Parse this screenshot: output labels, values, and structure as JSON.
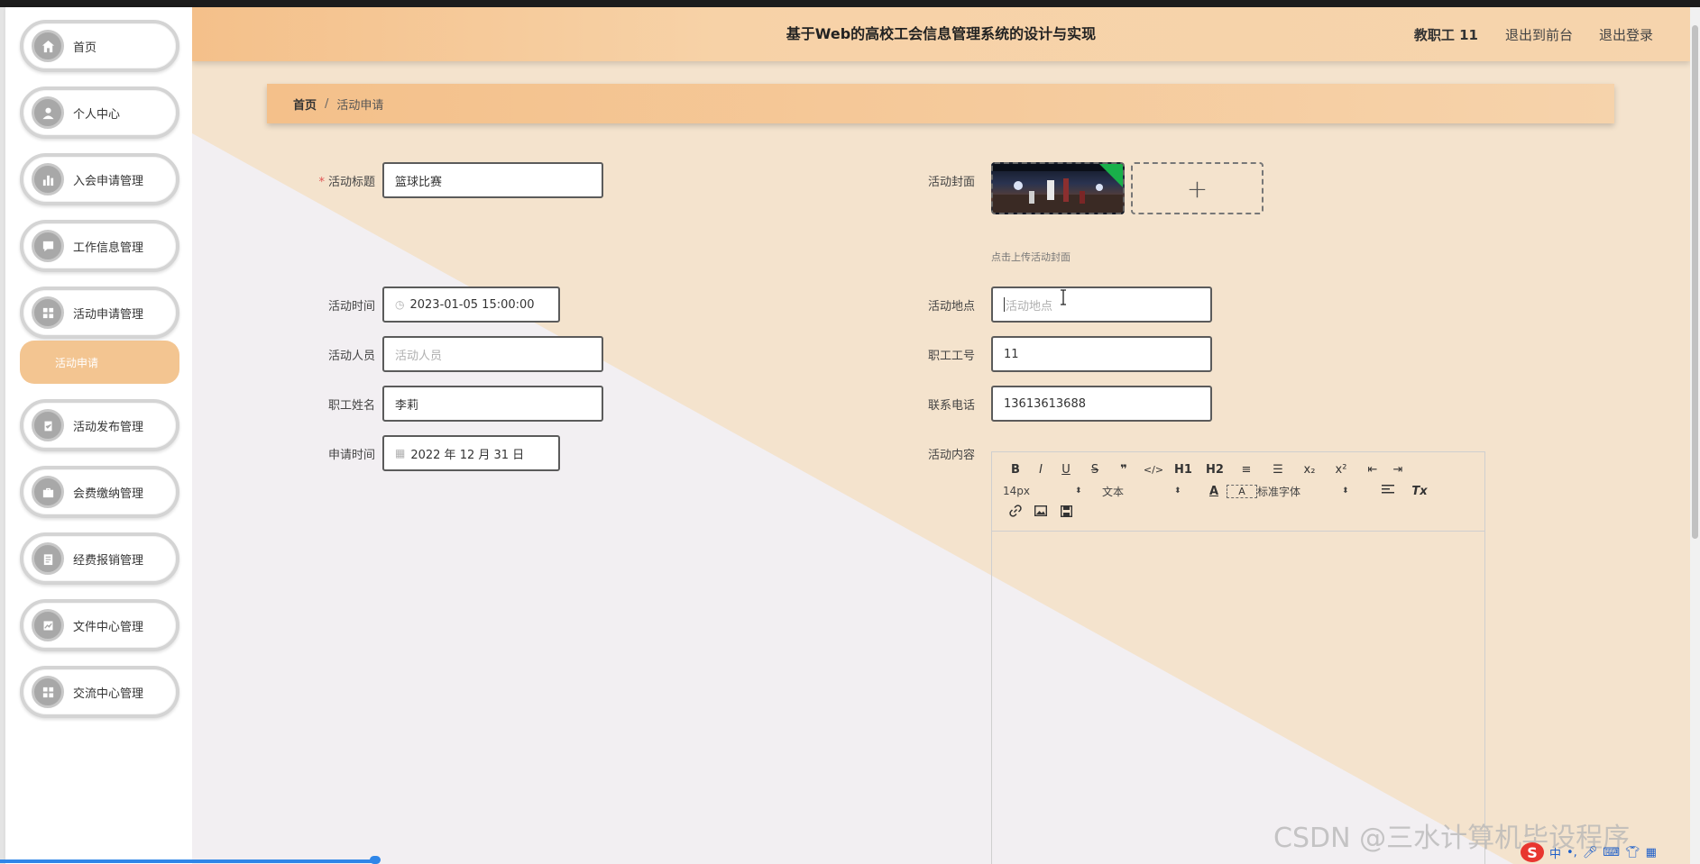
{
  "header": {
    "title": "基于Web的高校工会信息管理系统的设计与实现",
    "user": "教职工 11",
    "links": [
      "退出到前台",
      "退出登录"
    ]
  },
  "sidebar": {
    "items": [
      {
        "label": "首页",
        "icon": "home-icon"
      },
      {
        "label": "个人中心",
        "icon": "user-icon"
      },
      {
        "label": "入会申请管理",
        "icon": "bar-chart-icon"
      },
      {
        "label": "工作信息管理",
        "icon": "chat-icon"
      },
      {
        "label": "活动申请管理",
        "icon": "grid-icon"
      },
      {
        "label": "活动发布管理",
        "icon": "clipboard-check-icon"
      },
      {
        "label": "会费缴纳管理",
        "icon": "briefcase-icon"
      },
      {
        "label": "经费报销管理",
        "icon": "clipboard-icon"
      },
      {
        "label": "文件中心管理",
        "icon": "image-chart-icon"
      },
      {
        "label": "交流中心管理",
        "icon": "grid-icon"
      }
    ],
    "active_sub": "活动申请"
  },
  "breadcrumb": {
    "home": "首页",
    "sep": "/",
    "current": "活动申请"
  },
  "form": {
    "title": {
      "label": "活动标题",
      "required_mark": "*",
      "value": "篮球比赛"
    },
    "cover": {
      "label": "活动封面",
      "tip": "点击上传活动封面",
      "add": "+"
    },
    "time": {
      "label": "活动时间",
      "value": "2023-01-05 15:00:00"
    },
    "place": {
      "label": "活动地点",
      "placeholder": "活动地点"
    },
    "people": {
      "label": "活动人员",
      "placeholder": "活动人员"
    },
    "staff_no": {
      "label": "职工工号",
      "value": "11"
    },
    "staff_name": {
      "label": "职工姓名",
      "value": "李莉"
    },
    "phone": {
      "label": "联系电话",
      "value": "13613613688"
    },
    "apply_time": {
      "label": "申请时间",
      "value": "2022 年 12 月 31 日"
    },
    "content": {
      "label": "活动内容"
    }
  },
  "editor": {
    "row1": [
      "B",
      "I",
      "U",
      "S",
      "❞",
      "</>",
      "H1",
      "H2",
      "≡",
      "☰",
      "x₂",
      "x²",
      "⇤",
      "⇥"
    ],
    "font_size": "14px",
    "header_sel": "文本",
    "font_family": "标准字体",
    "color_btn": "A",
    "bg_btn": "A",
    "clear_btn": "Tx"
  },
  "watermark": "CSDN @三水计算机毕设程序",
  "ime": {
    "logo": "S",
    "lang": "中"
  },
  "colors": {
    "accent": "#f3c591",
    "header": "#f4c08a"
  }
}
